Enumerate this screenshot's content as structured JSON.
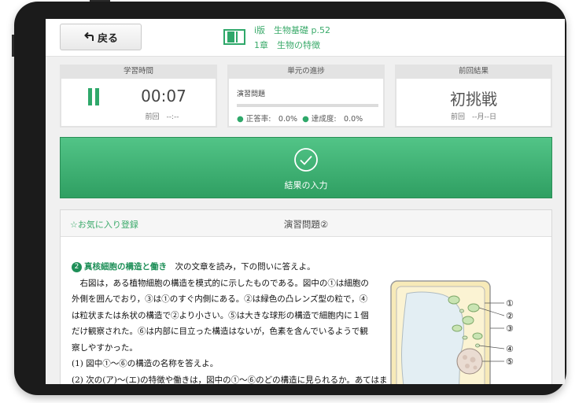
{
  "header": {
    "back_label": "戻る",
    "book_line1": "ⅰ版　生物基礎 p.52",
    "book_line2": "1章　生物の特徴"
  },
  "stats": {
    "study_time": {
      "title": "学習時間",
      "value": "00:07",
      "previous": "前回　--:--"
    },
    "progress": {
      "title": "単元の進捗",
      "label": "演習問題",
      "fill": 0,
      "accuracy": "正答率:　0.0%",
      "completion": "達成度:　0.0%"
    },
    "last_result": {
      "title": "前回結果",
      "value": "初挑戦",
      "previous": "前回　--月--日"
    }
  },
  "input_button": {
    "label": "結果の入力"
  },
  "problem": {
    "favorite": "☆お気に入り登録",
    "title": "演習問題②",
    "number": "2",
    "heading": "真核細胞の構造と働き",
    "instruction": "次の文章を読み，下の問いに答えよ。",
    "lines": [
      "　右図は，ある植物細胞の構造を模式的に示したものである。図中の①は細胞の",
      "外側を囲んでおり，③は①のすぐ内側にある。②は緑色の凸レンズ型の粒で，④",
      "は粒状または糸状の構造で②より小さい。⑤は大きな球形の構造で細胞内に１個",
      "だけ観察された。⑥は内部に目立った構造はないが，色素を含んでいるようで観",
      "察しやすかった。",
      "(1) 図中①～⑥の構造の名称を答えよ。",
      "(2) 次の(ア)～(エ)の特徴や働きは，図中の①～⑥のどの構造に見られるか。あてはま"
    ],
    "figure_labels": [
      "①",
      "②",
      "③",
      "④",
      "⑤"
    ]
  },
  "colors": {
    "accent": "#2fa86a",
    "button": "#3db375"
  }
}
